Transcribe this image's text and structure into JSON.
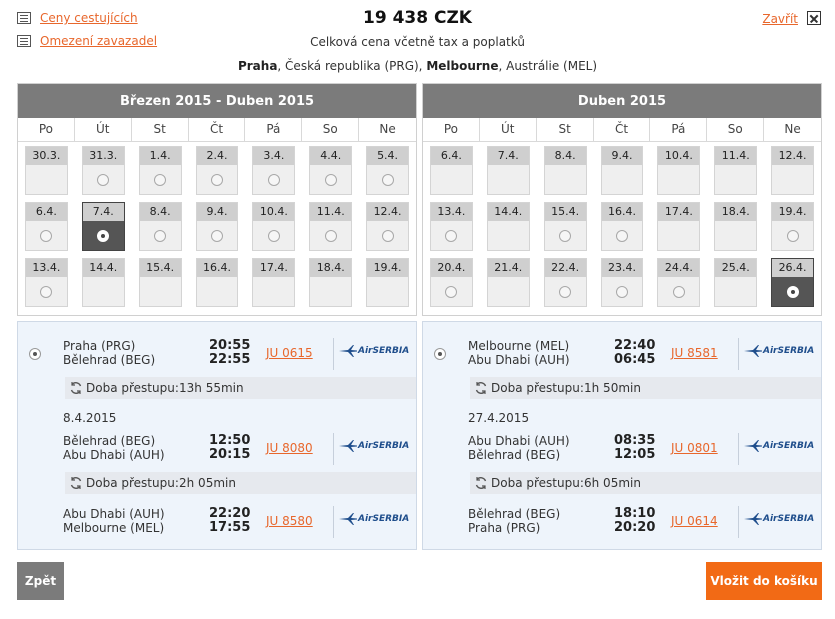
{
  "header": {
    "link_prices": "Ceny cestujících",
    "link_baggage": "Omezení zavazadel",
    "price": "19 438 CZK",
    "price_note": "Celková cena včetně tax a poplatků",
    "route": {
      "from_city": "Praha",
      "from_rest": ", Česká republika (PRG), ",
      "to_city": "Melbourne",
      "to_rest": ", Austrálie (MEL)"
    },
    "close_label": "Zavřít"
  },
  "weekdays": [
    "Po",
    "Út",
    "St",
    "Čt",
    "Pá",
    "So",
    "Ne"
  ],
  "outbound_calendar": {
    "title": "Březen 2015 - Duben 2015",
    "days": [
      {
        "label": "30.3.",
        "radio": false,
        "selected": false
      },
      {
        "label": "31.3.",
        "radio": true,
        "selected": false
      },
      {
        "label": "1.4.",
        "radio": true,
        "selected": false
      },
      {
        "label": "2.4.",
        "radio": true,
        "selected": false
      },
      {
        "label": "3.4.",
        "radio": true,
        "selected": false
      },
      {
        "label": "4.4.",
        "radio": true,
        "selected": false
      },
      {
        "label": "5.4.",
        "radio": true,
        "selected": false
      },
      {
        "label": "6.4.",
        "radio": true,
        "selected": false
      },
      {
        "label": "7.4.",
        "radio": true,
        "selected": true
      },
      {
        "label": "8.4.",
        "radio": true,
        "selected": false
      },
      {
        "label": "9.4.",
        "radio": true,
        "selected": false
      },
      {
        "label": "10.4.",
        "radio": true,
        "selected": false
      },
      {
        "label": "11.4.",
        "radio": true,
        "selected": false
      },
      {
        "label": "12.4.",
        "radio": true,
        "selected": false
      },
      {
        "label": "13.4.",
        "radio": true,
        "selected": false
      },
      {
        "label": "14.4.",
        "radio": false,
        "selected": false
      },
      {
        "label": "15.4.",
        "radio": false,
        "selected": false
      },
      {
        "label": "16.4.",
        "radio": false,
        "selected": false
      },
      {
        "label": "17.4.",
        "radio": false,
        "selected": false
      },
      {
        "label": "18.4.",
        "radio": false,
        "selected": false
      },
      {
        "label": "19.4.",
        "radio": false,
        "selected": false
      }
    ]
  },
  "return_calendar": {
    "title": "Duben 2015",
    "days": [
      {
        "label": "6.4.",
        "radio": false,
        "selected": false
      },
      {
        "label": "7.4.",
        "radio": false,
        "selected": false
      },
      {
        "label": "8.4.",
        "radio": false,
        "selected": false
      },
      {
        "label": "9.4.",
        "radio": false,
        "selected": false
      },
      {
        "label": "10.4.",
        "radio": false,
        "selected": false
      },
      {
        "label": "11.4.",
        "radio": false,
        "selected": false
      },
      {
        "label": "12.4.",
        "radio": false,
        "selected": false
      },
      {
        "label": "13.4.",
        "radio": true,
        "selected": false
      },
      {
        "label": "14.4.",
        "radio": false,
        "selected": false
      },
      {
        "label": "15.4.",
        "radio": true,
        "selected": false
      },
      {
        "label": "16.4.",
        "radio": true,
        "selected": false
      },
      {
        "label": "17.4.",
        "radio": false,
        "selected": false
      },
      {
        "label": "18.4.",
        "radio": false,
        "selected": false
      },
      {
        "label": "19.4.",
        "radio": true,
        "selected": false
      },
      {
        "label": "20.4.",
        "radio": true,
        "selected": false
      },
      {
        "label": "21.4.",
        "radio": false,
        "selected": false
      },
      {
        "label": "22.4.",
        "radio": true,
        "selected": false
      },
      {
        "label": "23.4.",
        "radio": true,
        "selected": false
      },
      {
        "label": "24.4.",
        "radio": true,
        "selected": false
      },
      {
        "label": "25.4.",
        "radio": false,
        "selected": false
      },
      {
        "label": "26.4.",
        "radio": true,
        "selected": true
      }
    ]
  },
  "outbound_flights": {
    "seg1": {
      "from": "Praha (PRG)",
      "to": "Bělehrad (BEG)",
      "dep": "20:55",
      "arr": "22:55",
      "flight": "JU 0615"
    },
    "transfer1": {
      "label": "Doba přestupu:",
      "duration": "13h 55min"
    },
    "date2": "8.4.2015",
    "seg2": {
      "from": "Bělehrad (BEG)",
      "to": "Abu Dhabi (AUH)",
      "dep": "12:50",
      "arr": "20:15",
      "flight": "JU 8080"
    },
    "transfer2": {
      "label": "Doba přestupu:",
      "duration": "2h 05min"
    },
    "seg3": {
      "from": "Abu Dhabi (AUH)",
      "to": "Melbourne (MEL)",
      "dep": "22:20",
      "arr": "17:55",
      "flight": "JU 8580"
    }
  },
  "return_flights": {
    "seg1": {
      "from": "Melbourne (MEL)",
      "to": "Abu Dhabi (AUH)",
      "dep": "22:40",
      "arr": "06:45",
      "flight": "JU 8581"
    },
    "transfer1": {
      "label": "Doba přestupu:",
      "duration": "1h 50min"
    },
    "date2": "27.4.2015",
    "seg2": {
      "from": "Abu Dhabi (AUH)",
      "to": "Bělehrad (BEG)",
      "dep": "08:35",
      "arr": "12:05",
      "flight": "JU 0801"
    },
    "transfer2": {
      "label": "Doba přestupu:",
      "duration": "6h 05min"
    },
    "seg3": {
      "from": "Bělehrad (BEG)",
      "to": "Praha (PRG)",
      "dep": "18:10",
      "arr": "20:20",
      "flight": "JU 0614"
    }
  },
  "airline": {
    "name": "AirSERBIA",
    "icon": "airserbia-logo-icon"
  },
  "buttons": {
    "back": "Zpět",
    "add_to_cart": "Vložit do košíku"
  },
  "colors": {
    "accent": "#e8672c",
    "cart_button": "#f26a15",
    "header_gray": "#7b7b7b",
    "flight_panel": "#eef4fb"
  }
}
